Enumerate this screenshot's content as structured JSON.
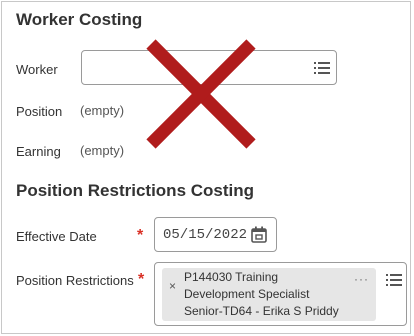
{
  "worker_costing": {
    "title": "Worker Costing",
    "worker_label": "Worker",
    "worker_value": "",
    "position_label": "Position",
    "position_value": "(empty)",
    "earning_label": "Earning",
    "earning_value": "(empty)"
  },
  "position_restrictions_costing": {
    "title": "Position Restrictions Costing",
    "effective_date_label": "Effective Date",
    "effective_date_value": "05/15/2022",
    "position_restrictions_label": "Position Restrictions",
    "required_mark": "*",
    "selected_chip": {
      "line1": "P144030 Training",
      "line2": "Development Specialist",
      "line3": "Senior-TD64 - Erika S Priddy",
      "remove_glyph": "×",
      "more_glyph": "···"
    }
  },
  "colors": {
    "overlay_x": "#b01c1c",
    "required": "#d93025",
    "chip_bg": "#e6e6e6"
  },
  "icons": [
    "list-icon",
    "calendar-icon",
    "remove-icon",
    "more-icon",
    "x-mark-overlay"
  ]
}
